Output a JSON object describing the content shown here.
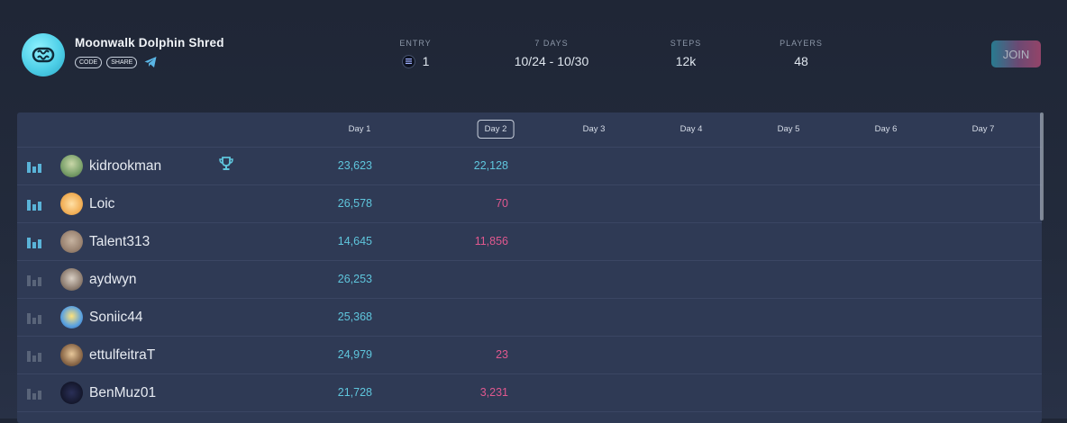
{
  "header": {
    "title": "Moonwalk Dolphin Shred",
    "chips": [
      "CODE",
      "SHARE"
    ],
    "entry": {
      "label": "ENTRY",
      "value": "1"
    },
    "days": {
      "label": "7 DAYS",
      "value": "10/24 - 10/30"
    },
    "steps": {
      "label": "STEPS",
      "value": "12k"
    },
    "players": {
      "label": "PLAYERS",
      "value": "48"
    },
    "join_label": "JOIN"
  },
  "table": {
    "days": [
      "Day 1",
      "Day 2",
      "Day 3",
      "Day 4",
      "Day 5",
      "Day 6",
      "Day 7"
    ],
    "active_day": "Day 2",
    "rows": [
      {
        "name": "kidrookman",
        "day1": "23,623",
        "day2": "22,128",
        "active": true,
        "trophy": true
      },
      {
        "name": "Loic",
        "day1": "26,578",
        "day2": "70",
        "active": true
      },
      {
        "name": "Talent313",
        "day1": "14,645",
        "day2": "11,856",
        "active": true
      },
      {
        "name": "aydwyn",
        "day1": "26,253",
        "day2": "",
        "active": false
      },
      {
        "name": "Soniic44",
        "day1": "25,368",
        "day2": "",
        "active": false
      },
      {
        "name": "ettulfeitraT",
        "day1": "24,979",
        "day2": "23",
        "active": false
      },
      {
        "name": "BenMuz01",
        "day1": "21,728",
        "day2": "3,231",
        "active": false
      }
    ]
  },
  "colors": {
    "accent_cyan": "#5fc6dd",
    "accent_pink": "#e0588f",
    "bar_active": "#5ab3d8",
    "bar_inactive": "#596479"
  },
  "icons": {
    "logo": "dolphin-logo-icon",
    "telegram": "telegram-icon",
    "token": "solana-token-icon",
    "trophy": "trophy-icon",
    "bars": "bar-chart-icon"
  }
}
